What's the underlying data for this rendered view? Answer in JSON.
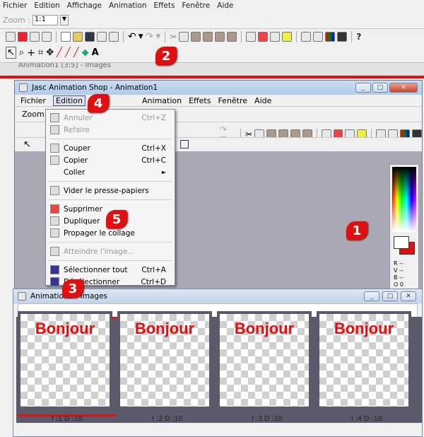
{
  "app_menu": [
    "Fichier",
    "Edition",
    "Affichage",
    "Animation",
    "Effets",
    "Fenêtre",
    "Aide"
  ],
  "zoom": {
    "label": "Zoom :",
    "value": "1:1"
  },
  "bg_window_title": "Animation1 [3:5] - Images",
  "inner_window": {
    "title": "Jasc Animation Shop - Animation1",
    "menu": [
      "Fichier",
      "Edition",
      "Animation",
      "Effets",
      "Fenêtre",
      "Aide"
    ],
    "zoom_label": "Zoom :"
  },
  "edit_menu": [
    {
      "label": "Annuler",
      "shortcut": "Ctrl+Z",
      "disabled": true,
      "icon": "undo-icon"
    },
    {
      "label": "Refaire",
      "shortcut": "",
      "disabled": true,
      "icon": "redo-icon"
    },
    {
      "sep": true
    },
    {
      "label": "Couper",
      "shortcut": "Ctrl+X",
      "disabled": false,
      "icon": "scissors-icon"
    },
    {
      "label": "Copier",
      "shortcut": "Ctrl+C",
      "disabled": false,
      "icon": "copy-icon"
    },
    {
      "label": "Coller",
      "shortcut": "►",
      "disabled": false,
      "icon": ""
    },
    {
      "sep": true
    },
    {
      "label": "Vider le presse-papiers",
      "shortcut": "",
      "disabled": false,
      "icon": "clear-clipboard-icon"
    },
    {
      "sep": true
    },
    {
      "label": "Supprimer",
      "shortcut": "",
      "disabled": false,
      "icon": "delete-icon"
    },
    {
      "label": "Dupliquer",
      "shortcut": "",
      "disabled": false,
      "icon": "duplicate-icon"
    },
    {
      "label": "Propager le collage",
      "shortcut": "",
      "disabled": false,
      "icon": "propagate-paste-icon"
    },
    {
      "sep": true
    },
    {
      "label": "Atteindre l'image...",
      "shortcut": "",
      "disabled": true,
      "icon": "goto-frame-icon"
    },
    {
      "sep": true
    },
    {
      "label": "Sélectionner tout",
      "shortcut": "Ctrl+A",
      "disabled": false,
      "icon": "select-all-icon"
    },
    {
      "label": "Désélectionner",
      "shortcut": "Ctrl+D",
      "disabled": false,
      "icon": "deselect-icon"
    }
  ],
  "frames_window": {
    "title": "Animation3 - Images",
    "frames": [
      {
        "text": "Bonjour",
        "label": "I :1  D :10"
      },
      {
        "text": "Bonjour",
        "label": "I :2  D :10"
      },
      {
        "text": "Bonjour",
        "label": "I :3  D :10"
      },
      {
        "text": "Bonjour",
        "label": "I :4  D :10"
      }
    ]
  },
  "color_panel": {
    "lines": [
      "R --",
      "V --",
      "B --",
      "O 0"
    ]
  },
  "callouts": [
    "1",
    "2",
    "3",
    "4",
    "5"
  ],
  "colors": {
    "accent_red": "#e01010",
    "titlebar": "#b9cfe9"
  }
}
